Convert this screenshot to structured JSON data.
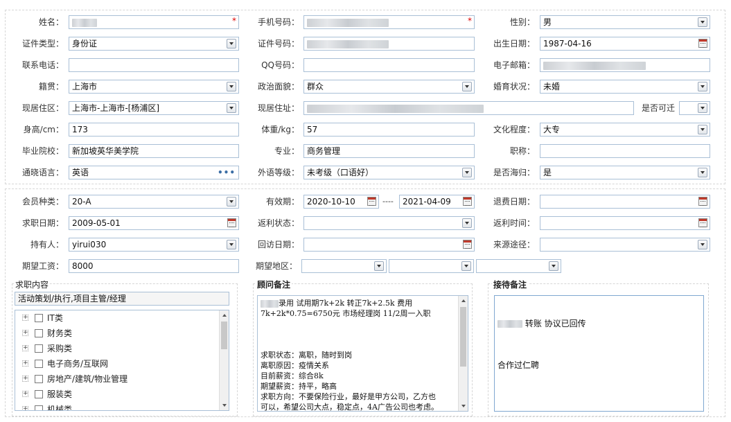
{
  "profile": {
    "name": {
      "label": "姓名："
    },
    "phone": {
      "label": "手机号码："
    },
    "gender": {
      "label": "性别：",
      "value": "男"
    },
    "id_type": {
      "label": "证件类型：",
      "value": "身份证"
    },
    "id_number": {
      "label": "证件号码："
    },
    "birth_date": {
      "label": "出生日期：",
      "value": "1987-04-16"
    },
    "contact_phone": {
      "label": "联系电话：",
      "value": ""
    },
    "qq": {
      "label": "QQ号码：",
      "value": ""
    },
    "email": {
      "label": "电子邮箱："
    },
    "native_place": {
      "label": "籍贯：",
      "value": "上海市"
    },
    "political_status": {
      "label": "政治面貌：",
      "value": "群众"
    },
    "marital_status": {
      "label": "婚育状况：",
      "value": "未婚"
    },
    "residence_area": {
      "label": "现居住区：",
      "value": "上海市-上海市-[杨浦区]"
    },
    "residence_address": {
      "label": "现居住址："
    },
    "can_relocate": {
      "label": "是否可迁",
      "value": ""
    },
    "height": {
      "label": "身高/cm：",
      "value": "173"
    },
    "weight": {
      "label": "体重/kg：",
      "value": "57"
    },
    "education": {
      "label": "文化程度：",
      "value": "大专"
    },
    "school": {
      "label": "毕业院校：",
      "value": "新加坡英华美学院"
    },
    "major": {
      "label": "专业：",
      "value": "商务管理"
    },
    "title": {
      "label": "职称：",
      "value": ""
    },
    "language": {
      "label": "通晓语言：",
      "value": "英语",
      "more": "•••"
    },
    "foreign_level": {
      "label": "外语等级：",
      "value": "未考级（口语好）"
    },
    "returnee": {
      "label": "是否海归：",
      "value": "是"
    }
  },
  "membership": {
    "member_type": {
      "label": "会员种类：",
      "value": "20-A"
    },
    "valid_period": {
      "label": "有效期：",
      "start": "2020-10-10",
      "sep": "----",
      "end": "2021-04-09"
    },
    "refund_date": {
      "label": "退费日期：",
      "value": ""
    },
    "job_seek_date": {
      "label": "求职日期：",
      "value": "2009-05-01"
    },
    "rebate_status": {
      "label": "返利状态：",
      "value": ""
    },
    "rebate_time": {
      "label": "返利时间：",
      "value": ""
    },
    "holder": {
      "label": "持有人：",
      "value": "yirui030"
    },
    "revisit_date": {
      "label": "回访日期：",
      "value": ""
    },
    "source": {
      "label": "来源途径：",
      "value": ""
    },
    "expected_salary": {
      "label": "期望工资：",
      "value": "8000"
    },
    "expected_region": {
      "label": "期望地区：",
      "values": [
        "",
        "",
        ""
      ]
    }
  },
  "job_content": {
    "title": "求职内容",
    "summary": "活动策划/执行,项目主管/经理",
    "tree": [
      "IT类",
      "财务类",
      "采购类",
      "电子商务/互联网",
      "房地产/建筑/物业管理",
      "服装类",
      "机械类"
    ],
    "plus": "+"
  },
  "consultant_notes": {
    "title": "顾问备注",
    "text": "录用 试用期7k+2k 转正7k+2.5k 费用\n7k+2k*0.75=6750元 市场经理岗 11/2周一入职\n\n\n\n求职状态：离职，随时到岗\n离职原因：疫情关系\n目前薪资：综合8k\n期望薪资：持平，略高\n求职方向：不要保险行业，最好是甲方公司，乙方也\n可以，希望公司大点，稳定点，4A广告公司也考虑。"
  },
  "reception_notes": {
    "title": "接待备注",
    "line1": "转账 协议已回传",
    "line2": "合作过仁聘"
  },
  "icons": {
    "dropdown": "chevron-down-icon",
    "calendar": "calendar-icon",
    "more": "ellipsis-icon"
  },
  "colors": {
    "border": "#a9bfd6",
    "required": "#dd0000",
    "link": "#3b6ea5"
  }
}
